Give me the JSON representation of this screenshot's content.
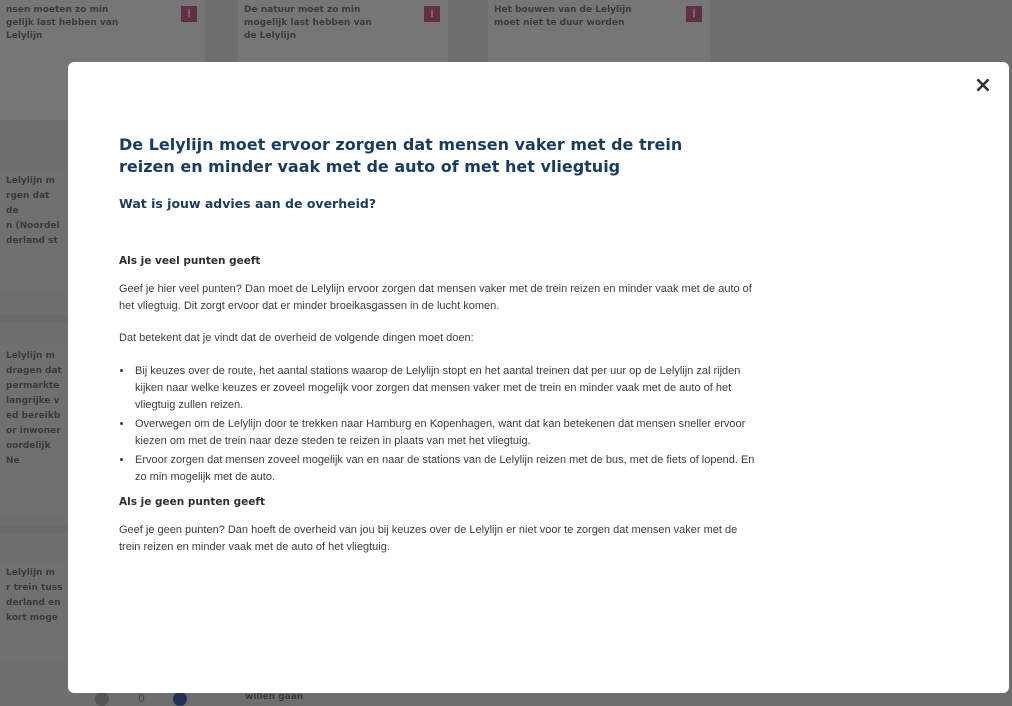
{
  "background": {
    "cards": [
      {
        "text": "nsen moeten zo min\ngelijk last hebben van\nLelylijn",
        "info": "i"
      },
      {
        "text": "De natuur moet zo min\nmogelijk last hebben van\nde Lelylijn",
        "info": "i"
      },
      {
        "text": "Het bouwen van de Lelylijn\nmoet niet te duur worden",
        "info": "i"
      }
    ],
    "left_items": [
      "Lelylijn m\nrgen dat de\nn (Noordel\nderland st",
      "Lelylijn m\ndragen dat\npermarkte\nlangrijke v\ned bereikb\nor inwoner\noordelijk Ne",
      "Lelylijn m\nr trein tuss\nderland en\nkort moge"
    ],
    "counter_value": "0",
    "bottom_text": "willen gaan"
  },
  "modal": {
    "close_icon": "×",
    "title": "De Lelylijn moet ervoor zorgen dat mensen vaker met de trein reizen en minder vaak met de auto of met het vliegtuig",
    "subtitle": "Wat is jouw advies aan de overheid?",
    "high_points_heading": "Als je veel punten geeft",
    "high_points_text": "Geef je hier veel punten? Dan moet de Lelylijn ervoor zorgen dat mensen vaker met de trein reizen en minder vaak met de auto of het vliegtuig. Dit zorgt ervoor dat er minder broeikasgassen in de lucht komen.",
    "means_text": "Dat betekent dat je vindt dat de overheid de volgende dingen moet doen:",
    "bullets": [
      "Bij keuzes over de route, het aantal stations waarop de Lelylijn stopt en het aantal treinen dat per uur op de Lelylijn zal rijden kijken naar welke keuzes er zoveel mogelijk voor zorgen dat mensen vaker met de trein en minder vaak met de auto of het vliegtuig zullen reizen.",
      "Overwegen om de Lelylijn door te trekken naar Hamburg en Kopenhagen, want dat kan betekenen dat mensen sneller ervoor kiezen om met de trein naar deze steden te reizen in plaats van met het vliegtuig.",
      "Ervoor zorgen dat mensen zoveel mogelijk van en naar de stations van de Lelylijn reizen met de bus, met de fiets of lopend. En zo min mogelijk met de auto."
    ],
    "no_points_heading": "Als je geen punten geeft",
    "no_points_text": "Geef je geen punten? Dan hoeft de overheid van jou bij keuzes over de Lelylijn er niet voor te zorgen dat mensen vaker met de trein reizen en minder vaak met de auto of het vliegtuig."
  }
}
